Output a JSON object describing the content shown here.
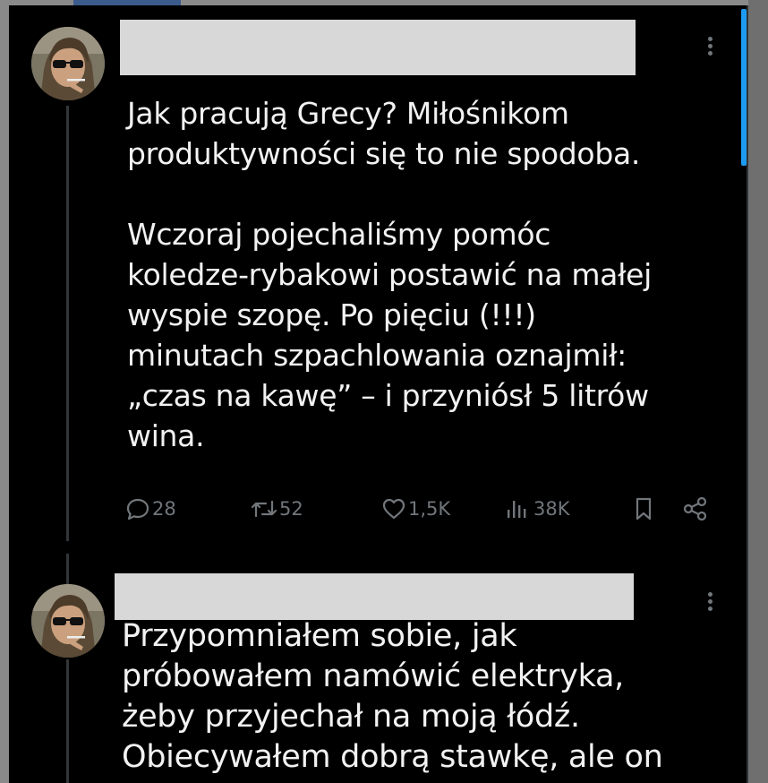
{
  "posts": [
    {
      "text": "Jak pracują Grecy? Miłośnikom\nproduktywności się to nie spodoba.\n\nWczoraj pojechaliśmy pomóc\nkoledze-rybakowi postawić na małej\nwyspie szopę. Po pięciu (!!!)\nminutach szpachlowania oznajmił:\n„czas na kawę” – i przyniósł 5 litrów\nwina.",
      "actions": {
        "replies": "28",
        "reposts": "52",
        "likes": "1,5K",
        "views": "38K"
      }
    },
    {
      "text": "Przypomniałem sobie, jak\npróbowałem namówić elektryka,\nżeby przyjechał na moją łódź.\nObiecywałem dobrą stawkę, ale on"
    }
  ],
  "icons": {
    "reply": "reply-icon",
    "repost": "repost-icon",
    "like": "like-icon",
    "views": "views-icon",
    "bookmark": "bookmark-icon",
    "share": "share-icon",
    "more": "more-options-icon"
  },
  "colors": {
    "background": "#000000",
    "text": "#f2f2f2",
    "muted": "#71767b",
    "accent": "#1d9bf0",
    "redaction": "#d8d8d8"
  }
}
